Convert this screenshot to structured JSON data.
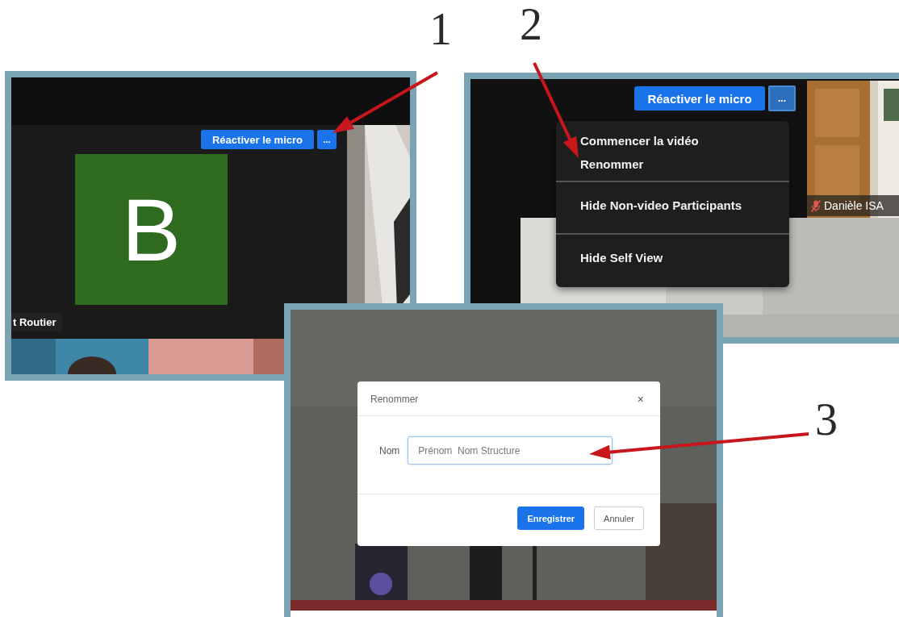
{
  "callouts": [
    {
      "number": "1"
    },
    {
      "number": "2"
    },
    {
      "number": "3"
    }
  ],
  "panel_1": {
    "unmute_button": "Réactiver le micro",
    "more_button": "...",
    "avatar_letter": "B",
    "participant_name": "t Routier"
  },
  "panel_2": {
    "unmute_button": "Réactiver le micro",
    "more_button": "...",
    "participant_name": "Danièle ISA",
    "muted": true,
    "menu_sections": [
      {
        "items": [
          {
            "label": "Commencer la vidéo"
          },
          {
            "label": "Renommer"
          }
        ]
      },
      {
        "items": [
          {
            "label": "Hide Non-video Participants"
          }
        ]
      },
      {
        "items": [
          {
            "label": "Hide Self View"
          }
        ]
      }
    ]
  },
  "panel_3": {
    "dialog": {
      "title": "Renommer",
      "close": "×",
      "field_label": "Nom",
      "placeholder": "Prénom  Nom Structure",
      "buttons": [
        {
          "label": "Enregistrer",
          "kind": "primary"
        },
        {
          "label": "Annuler",
          "kind": "secondary"
        }
      ]
    }
  }
}
